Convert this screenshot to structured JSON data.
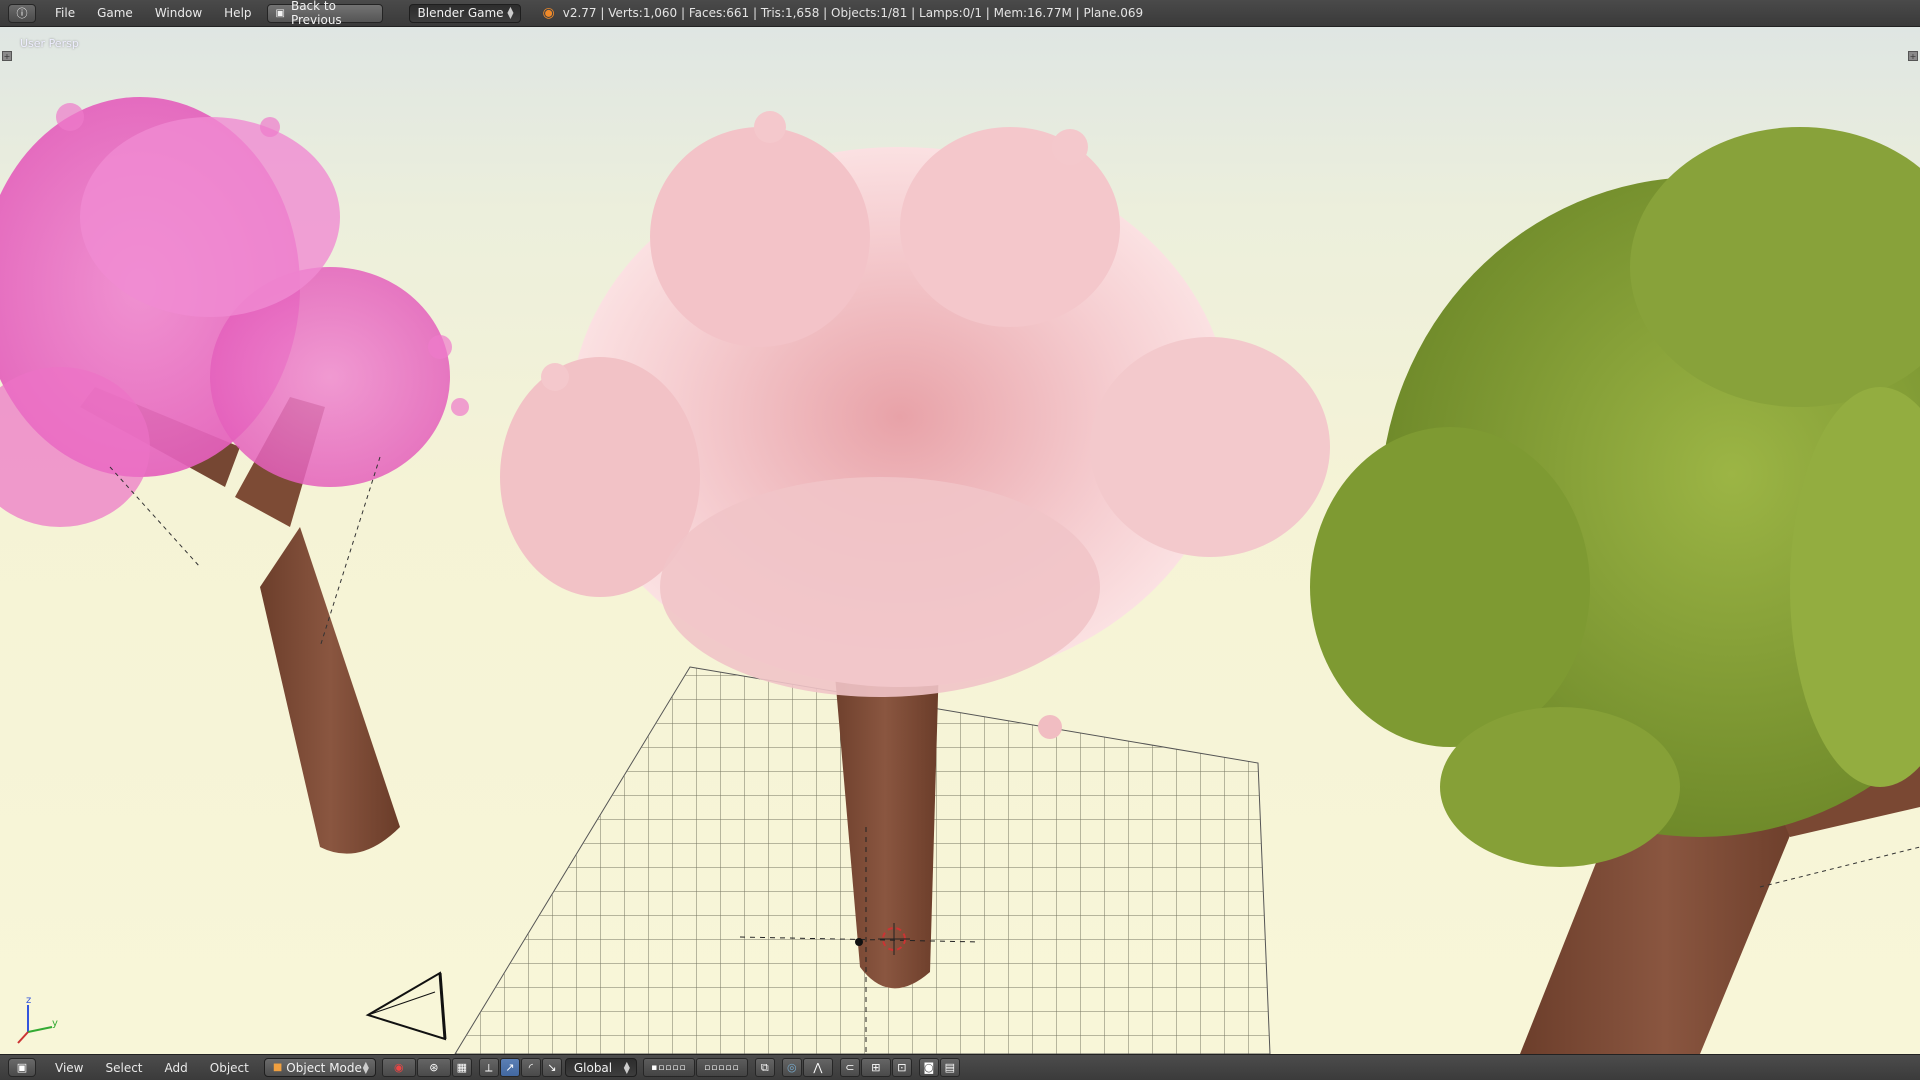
{
  "header": {
    "menus": [
      "File",
      "Game",
      "Window",
      "Help"
    ],
    "back_button": "Back to Previous",
    "engine": "Blender Game",
    "stats": "v2.77 | Verts:1,060 | Faces:661 | Tris:1,658 | Objects:1/81 | Lamps:0/1 | Mem:16.77M | Plane.069"
  },
  "viewport": {
    "label": "User Persp",
    "axis_labels": {
      "z": "z",
      "y": "y"
    }
  },
  "footer": {
    "menus": [
      "View",
      "Select",
      "Add",
      "Object"
    ],
    "mode": "Object Mode",
    "orientation": "Global"
  },
  "colors": {
    "trunk": "#7a4a34",
    "pink_foliage": "#ee79c8",
    "blossom": "#f4c2c8",
    "green_foliage": "#8aa23a"
  }
}
